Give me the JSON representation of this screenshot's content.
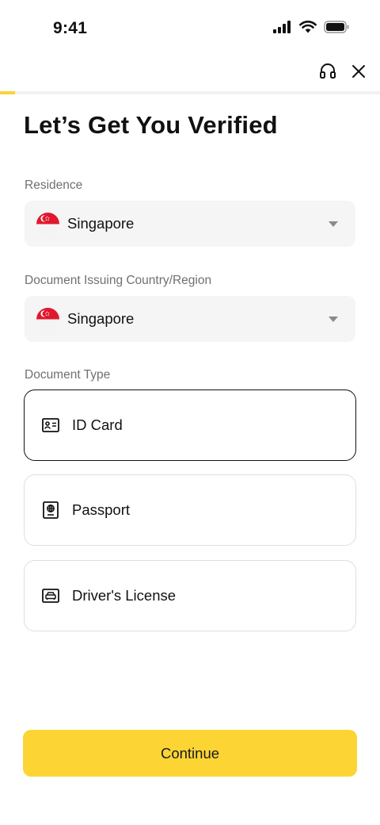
{
  "status_bar": {
    "time": "9:41"
  },
  "header": {
    "support_icon": "headset-icon",
    "close_icon": "close-icon",
    "progress_fraction": 0.04,
    "progress_color": "#f8d33a"
  },
  "page": {
    "title": "Let’s Get You Verified"
  },
  "residence": {
    "label": "Residence",
    "value": "Singapore",
    "flag_icon": "singapore-flag-icon"
  },
  "issuing_country": {
    "label": "Document Issuing Country/Region",
    "value": "Singapore",
    "flag_icon": "singapore-flag-icon"
  },
  "document_type": {
    "label": "Document Type",
    "options": [
      {
        "label": "ID Card",
        "icon": "id-card-icon",
        "selected": true
      },
      {
        "label": "Passport",
        "icon": "passport-icon",
        "selected": false
      },
      {
        "label": "Driver's License",
        "icon": "drivers-license-icon",
        "selected": false
      }
    ]
  },
  "footer": {
    "continue_label": "Continue",
    "accent_color": "#fcd535"
  }
}
